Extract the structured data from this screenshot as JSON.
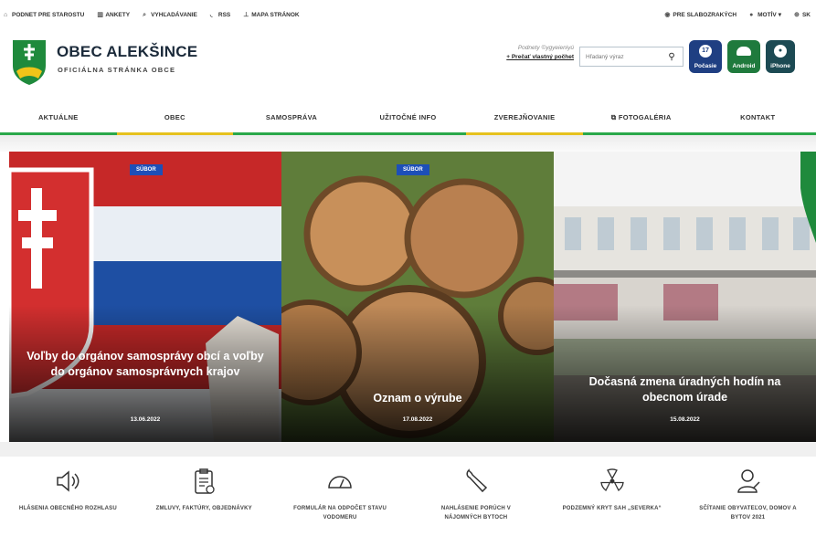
{
  "topbar": {
    "left": [
      {
        "label": "Podnet pre starostu",
        "icon": "home-icon"
      },
      {
        "label": "Ankety",
        "icon": "chart-icon"
      },
      {
        "label": "Vyhľadávanie",
        "icon": "search-icon"
      },
      {
        "label": "RSS",
        "icon": "rss-icon"
      },
      {
        "label": "Mapa stránok",
        "icon": "sitemap-icon"
      }
    ],
    "right": [
      {
        "label": "Pre slabozrakých",
        "icon": "eye-icon"
      },
      {
        "label": "Motív",
        "icon": "palette-icon"
      },
      {
        "label": "SK",
        "icon": "globe-icon"
      }
    ]
  },
  "header": {
    "name": "OBEC ALEKŠINCE",
    "subtitle": "OFICIÁLNA STRÁNKA OBCE",
    "login_text": "Podnety ©ygyeieniyú",
    "login_link": "+ Prečať vlastný počhet"
  },
  "search": {
    "placeholder": "Hľadaný výraz"
  },
  "apps": [
    {
      "label": "Počasie",
      "badge": "17",
      "color": "#1f3f82"
    },
    {
      "label": "Android",
      "badge": "",
      "color": "#1f7a3d"
    },
    {
      "label": "iPhone",
      "badge": "",
      "color": "#1c4a53"
    }
  ],
  "nav": [
    {
      "label": "Aktuálne",
      "accent": "green"
    },
    {
      "label": "Obec",
      "accent": "yellow"
    },
    {
      "label": "Samospráva",
      "accent": "green"
    },
    {
      "label": "Užitočné info",
      "accent": "green"
    },
    {
      "label": "Zverejňovanie",
      "accent": "yellow"
    },
    {
      "label": "Fotogaléria",
      "accent": "green"
    },
    {
      "label": "Kontakt",
      "accent": "green"
    }
  ],
  "slides": [
    {
      "badge": "",
      "title": "Voľby do orgánov samosprávy obcí a voľby do orgánov samosprávnych krajov",
      "date": "13.06.2022"
    },
    {
      "badge": "SÚBOR",
      "title": "Oznam o výrube",
      "date": "17.08.2022"
    },
    {
      "badge": "",
      "title": "Dočasná zmena úradných hodín na obecnom úrade",
      "date": "15.08.2022"
    }
  ],
  "slide_badge_1": "SÚBOR",
  "quick_links": [
    {
      "label": "Hlásenia obecného rozhlasu",
      "icon": "speaker-icon"
    },
    {
      "label": "Zmluvy, faktúry, objednávky",
      "icon": "clipboard-icon"
    },
    {
      "label": "Formulár na odpočet stavu vodomeru",
      "icon": "gauge-icon"
    },
    {
      "label": "Nahlásenie porúch v nájomných bytoch",
      "icon": "wrench-icon"
    },
    {
      "label": "Podzemný kryt SaH „Severka“",
      "icon": "radiation-icon"
    },
    {
      "label": "Sčítanie obyvateľov, domov a bytov 2021",
      "icon": "person-icon"
    }
  ]
}
